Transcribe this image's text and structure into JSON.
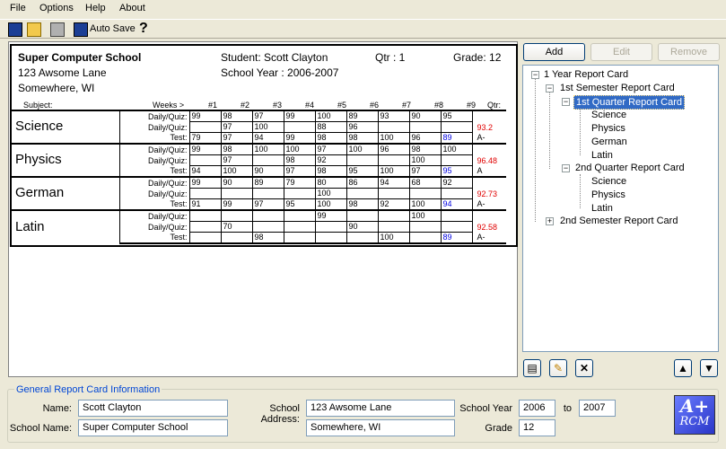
{
  "menu": [
    "File",
    "Options",
    "Help",
    "About"
  ],
  "toolbar": {
    "autosave_label": "Auto Save",
    "help_label": "?"
  },
  "report": {
    "school_name": "Super Computer School",
    "address1": "123 Awsome Lane",
    "address2": "Somewhere, WI",
    "student": "Student: Scott Clayton",
    "school_year": "School Year : 2006-2007",
    "qtr": "Qtr : 1",
    "grade": "Grade:  12",
    "subject_hdr": "Subject:",
    "weeks_hdr": "Weeks >",
    "week_labels": [
      "#1",
      "#2",
      "#3",
      "#4",
      "#5",
      "#6",
      "#7",
      "#8",
      "#9"
    ],
    "qtr_hdr": "Qtr:",
    "row_labels": [
      "Daily/Quiz:",
      "Daily/Quiz:",
      "Test:"
    ],
    "subjects": [
      {
        "name": "Science",
        "quarter": "93.2",
        "letter": "A-",
        "rows": [
          [
            "99",
            "98",
            "97",
            "99",
            "100",
            "89",
            "93",
            "90",
            "95"
          ],
          [
            "",
            "97",
            "100",
            "",
            "88",
            "96",
            "",
            "",
            ""
          ],
          [
            "79",
            "97",
            "94",
            "99",
            "98",
            "98",
            "100",
            "96",
            "89"
          ]
        ]
      },
      {
        "name": "Physics",
        "quarter": "96.48",
        "letter": "A",
        "rows": [
          [
            "99",
            "98",
            "100",
            "100",
            "97",
            "100",
            "96",
            "98",
            "100"
          ],
          [
            "",
            "97",
            "",
            "98",
            "92",
            "",
            "",
            "100",
            ""
          ],
          [
            "94",
            "100",
            "90",
            "97",
            "98",
            "95",
            "100",
            "97",
            "95"
          ]
        ]
      },
      {
        "name": "German",
        "quarter": "92.73",
        "letter": "A-",
        "rows": [
          [
            "99",
            "90",
            "89",
            "79",
            "80",
            "86",
            "94",
            "68",
            "92"
          ],
          [
            "",
            "",
            "",
            "",
            "100",
            "",
            "",
            "",
            ""
          ],
          [
            "91",
            "99",
            "97",
            "95",
            "100",
            "98",
            "92",
            "100",
            "94"
          ]
        ]
      },
      {
        "name": "Latin",
        "quarter": "92.58",
        "letter": "A-",
        "rows": [
          [
            "",
            "",
            "",
            "",
            "99",
            "",
            "",
            "100",
            ""
          ],
          [
            "",
            "70",
            "",
            "",
            "",
            "90",
            "",
            "",
            ""
          ],
          [
            "",
            "",
            "98",
            "",
            "",
            "",
            "100",
            "",
            "89"
          ]
        ]
      }
    ]
  },
  "buttons": {
    "add": "Add",
    "edit": "Edit",
    "remove": "Remove"
  },
  "tree": {
    "root": "1 Year Report Card",
    "sem1": "1st Semester Report Card",
    "q1": "1st Quarter Report Card",
    "q1_items": [
      "Science",
      "Physics",
      "German",
      "Latin"
    ],
    "q2": "2nd Quarter Report Card",
    "q2_items": [
      "Science",
      "Physics",
      "Latin"
    ],
    "sem2": "2nd Semester Report Card"
  },
  "info": {
    "legend": "General Report Card Information",
    "name_label": "Name:",
    "name_value": "Scott Clayton",
    "school_name_label": "School Name:",
    "school_name_value": "Super Computer School",
    "address_label": "School Address:",
    "address1": "123 Awsome Lane",
    "address2": "Somewhere, WI",
    "year_label": "School Year",
    "year_from": "2006",
    "to_label": "to",
    "year_to": "2007",
    "grade_label": "Grade",
    "grade_value": "12"
  },
  "logo": {
    "text": "A+",
    "sub": "RCM"
  },
  "colors": {
    "selection": "#316AC5",
    "average": "#E00000",
    "last_test": "#0000E0"
  }
}
